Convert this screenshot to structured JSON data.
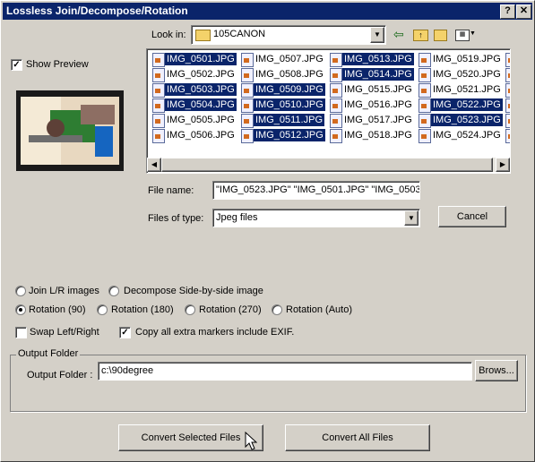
{
  "window": {
    "title": "Lossless Join/Decompose/Rotation",
    "help_btn": "?",
    "close_btn": "✕"
  },
  "preview": {
    "label": "Show Preview",
    "checked": true
  },
  "lookin": {
    "label": "Look in:",
    "value": "105CANON"
  },
  "files": [
    {
      "name": "IMG_0501.JPG",
      "selected": true
    },
    {
      "name": "IMG_0502.JPG",
      "selected": false
    },
    {
      "name": "IMG_0503.JPG",
      "selected": true
    },
    {
      "name": "IMG_0504.JPG",
      "selected": true
    },
    {
      "name": "IMG_0505.JPG",
      "selected": false
    },
    {
      "name": "IMG_0506.JPG",
      "selected": false
    },
    {
      "name": "IMG_0507.JPG",
      "selected": false
    },
    {
      "name": "IMG_0508.JPG",
      "selected": false
    },
    {
      "name": "IMG_0509.JPG",
      "selected": true
    },
    {
      "name": "IMG_0510.JPG",
      "selected": true
    },
    {
      "name": "IMG_0511.JPG",
      "selected": true
    },
    {
      "name": "IMG_0512.JPG",
      "selected": true
    },
    {
      "name": "IMG_0513.JPG",
      "selected": true
    },
    {
      "name": "IMG_0514.JPG",
      "selected": true
    },
    {
      "name": "IMG_0515.JPG",
      "selected": false
    },
    {
      "name": "IMG_0516.JPG",
      "selected": false
    },
    {
      "name": "IMG_0517.JPG",
      "selected": false
    },
    {
      "name": "IMG_0518.JPG",
      "selected": false
    },
    {
      "name": "IMG_0519.JPG",
      "selected": false
    },
    {
      "name": "IMG_0520.JPG",
      "selected": false
    },
    {
      "name": "IMG_0521.JPG",
      "selected": false
    },
    {
      "name": "IMG_0522.JPG",
      "selected": true
    },
    {
      "name": "IMG_0523.JPG",
      "selected": true
    },
    {
      "name": "IMG_0524.JPG",
      "selected": false
    }
  ],
  "filename": {
    "label": "File name:",
    "value": "\"IMG_0523.JPG\" \"IMG_0501.JPG\" \"IMG_0503"
  },
  "filetype": {
    "label": "Files of type:",
    "value": "Jpeg files"
  },
  "cancel_label": "Cancel",
  "options": {
    "join": "Join L/R images",
    "decompose": "Decompose Side-by-side image",
    "rot90": "Rotation (90)",
    "rot180": "Rotation (180)",
    "rot270": "Rotation (270)",
    "rotauto": "Rotation (Auto)",
    "selected": "rot90",
    "swap": "Swap Left/Right",
    "swap_checked": false,
    "copy_exif": "Copy all extra markers include EXIF.",
    "copy_exif_checked": true
  },
  "output": {
    "group_label": "Output Folder",
    "label": "Output Folder :",
    "value": "c:\\90degree",
    "browse": "Brows..."
  },
  "buttons": {
    "convert_selected": "Convert Selected Files",
    "convert_all": "Convert All Files"
  }
}
